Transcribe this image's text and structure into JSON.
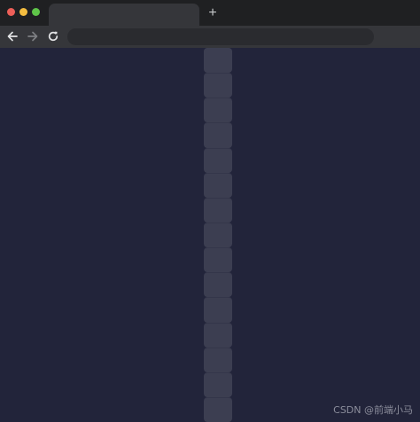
{
  "browser": {
    "tab": {
      "title": ""
    },
    "new_tab_symbol": "+",
    "toolbar": {
      "back_icon": "arrow-left-icon",
      "forward_icon": "arrow-right-icon",
      "reload_icon": "reload-icon"
    },
    "address_bar": {
      "value": "",
      "placeholder": ""
    }
  },
  "page": {
    "background_color": "#22243a",
    "column": {
      "color": "#3c3e51",
      "segment_count": 15
    },
    "watermark": "CSDN @前端小马"
  }
}
